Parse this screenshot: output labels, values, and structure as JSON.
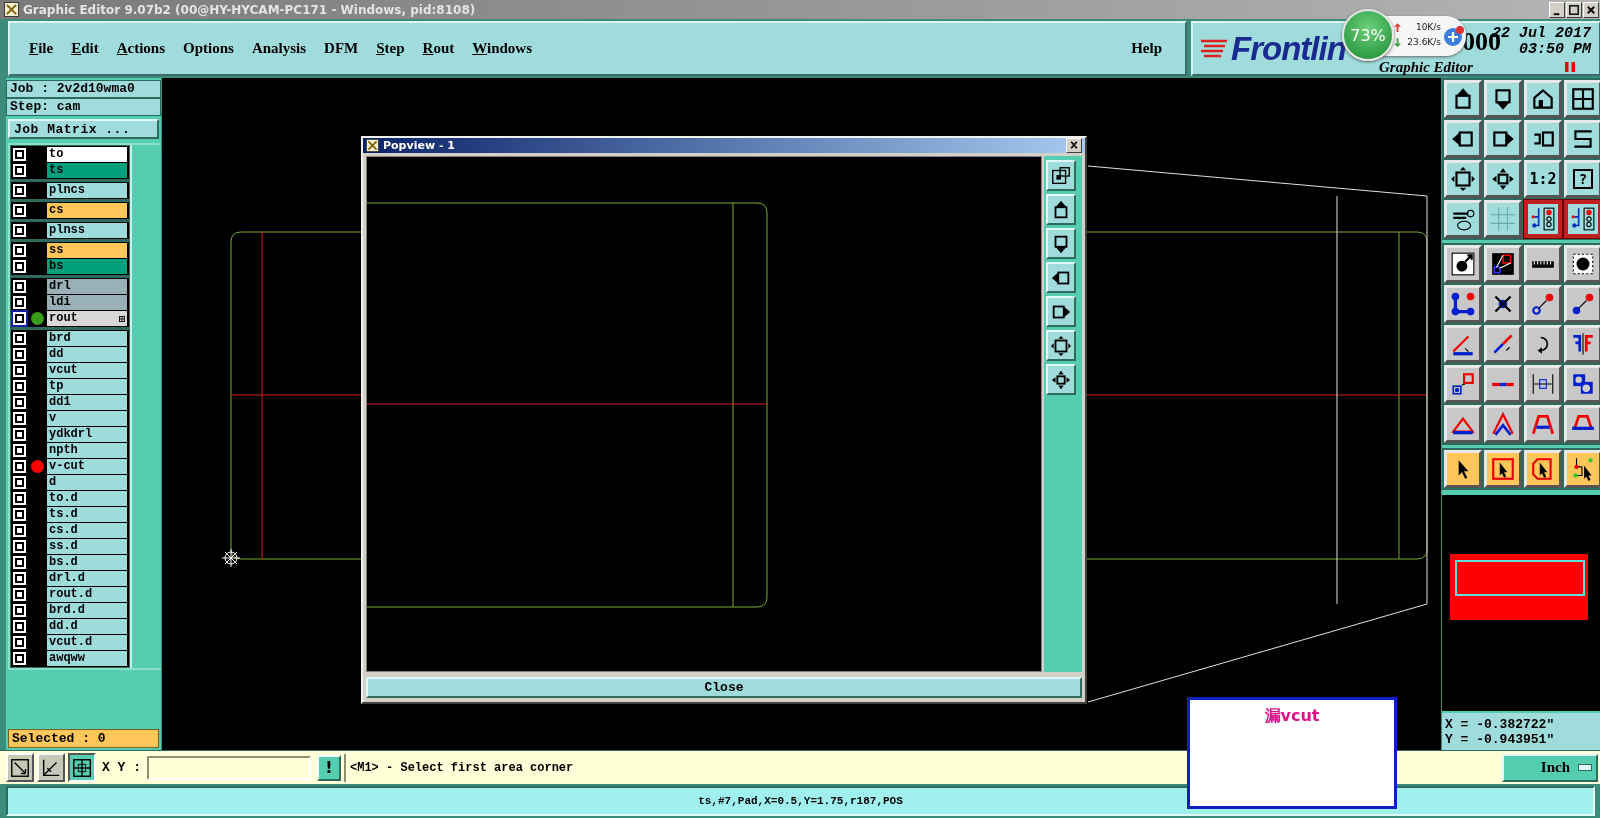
{
  "window": {
    "title": "Graphic Editor 9.07b2 (00@HY-HYCAM-PC171 - Windows, pid:8108)"
  },
  "menu": [
    {
      "label": "File",
      "mnemonic": true
    },
    {
      "label": "Edit",
      "mnemonic": true
    },
    {
      "label": "Actions",
      "mnemonic": true
    },
    {
      "label": "Options",
      "mnemonic": false
    },
    {
      "label": "Analysis",
      "mnemonic": false
    },
    {
      "label": "DFM",
      "mnemonic": false
    },
    {
      "label": "Step",
      "mnemonic": true
    },
    {
      "label": "Rout",
      "mnemonic": true
    },
    {
      "label": "Windows",
      "mnemonic": true
    }
  ],
  "help": "Help",
  "logo": {
    "brand": "Frontlin",
    "version": "000",
    "product": "Graphic Editor",
    "date": "22 Jul 2017",
    "time": "03:50 PM"
  },
  "net_widget": {
    "percent": "73%",
    "upload": "10K/s",
    "download": "23.6K/s"
  },
  "job": {
    "job": "Job : 2v2d10wma0",
    "step": "Step: cam",
    "matrix_button": "Job Matrix ..."
  },
  "layer_groups": [
    [
      {
        "name": "to",
        "color": "#ffffff",
        "selected": false
      },
      {
        "name": "ts",
        "color": "#00a07c",
        "selected": false
      }
    ],
    [
      {
        "name": "plncs",
        "color": "#9edcdc",
        "selected": false
      }
    ],
    [
      {
        "name": "cs",
        "color": "#ffc65a",
        "selected": false
      }
    ],
    [
      {
        "name": "plnss",
        "color": "#9edcdc",
        "selected": false
      }
    ],
    [
      {
        "name": "ss",
        "color": "#ffc65a",
        "selected": false
      },
      {
        "name": "bs",
        "color": "#00a07c",
        "selected": false
      }
    ],
    [
      {
        "name": "drl",
        "color": "#9ab0b8",
        "selected": false
      },
      {
        "name": "ldi",
        "color": "#9ab0b8",
        "selected": false
      },
      {
        "name": "rout",
        "color": "#d8d8d8",
        "selected": true,
        "marker": {
          "color": "#3a9a1a"
        }
      }
    ],
    [
      {
        "name": "brd",
        "color": "#9edcdc",
        "selected": false
      },
      {
        "name": "dd",
        "color": "#9edcdc",
        "selected": false
      },
      {
        "name": "vcut",
        "color": "#9edcdc",
        "selected": false
      },
      {
        "name": "tp",
        "color": "#9edcdc",
        "selected": false
      },
      {
        "name": "dd1",
        "color": "#9edcdc",
        "selected": false
      },
      {
        "name": "v",
        "color": "#9edcdc",
        "selected": false
      },
      {
        "name": "ydkdrl",
        "color": "#9edcdc",
        "selected": false
      },
      {
        "name": "npth",
        "color": "#9edcdc",
        "selected": false
      },
      {
        "name": "v-cut",
        "color": "#9edcdc",
        "selected": false,
        "marker": {
          "color": "#ff0000"
        }
      },
      {
        "name": "d",
        "color": "#9edcdc",
        "selected": false
      },
      {
        "name": "to.d",
        "color": "#9edcdc",
        "selected": false
      },
      {
        "name": "ts.d",
        "color": "#9edcdc",
        "selected": false
      },
      {
        "name": "cs.d",
        "color": "#9edcdc",
        "selected": false
      },
      {
        "name": "ss.d",
        "color": "#9edcdc",
        "selected": false
      },
      {
        "name": "bs.d",
        "color": "#9edcdc",
        "selected": false
      },
      {
        "name": "drl.d",
        "color": "#9edcdc",
        "selected": false
      },
      {
        "name": "rout.d",
        "color": "#9edcdc",
        "selected": false
      },
      {
        "name": "brd.d",
        "color": "#9edcdc",
        "selected": false
      },
      {
        "name": "dd.d",
        "color": "#9edcdc",
        "selected": false
      },
      {
        "name": "vcut.d",
        "color": "#9edcdc",
        "selected": false
      },
      {
        "name": "awqww",
        "color": "#9edcdc",
        "selected": false
      }
    ]
  ],
  "selected_count": "Selected : 0",
  "popview": {
    "title": "Popview - 1",
    "close": "Close",
    "tools": [
      {
        "kind": "zoom-box"
      },
      {
        "kind": "move-up"
      },
      {
        "kind": "move-down"
      },
      {
        "kind": "move-left"
      },
      {
        "kind": "move-right"
      },
      {
        "kind": "zoom-fit"
      },
      {
        "kind": "zoom-center"
      }
    ]
  },
  "palette": [
    {
      "kind": "view",
      "tools": [
        {
          "kind": "move-up",
          "on": false
        },
        {
          "kind": "move-down",
          "on": false
        },
        {
          "kind": "home",
          "on": false
        },
        {
          "kind": "xy-grid",
          "on": false
        },
        {
          "kind": "move-left",
          "on": false
        },
        {
          "kind": "move-right",
          "on": false
        },
        {
          "kind": "undo-box",
          "on": false
        },
        {
          "kind": "snake",
          "on": false
        },
        {
          "kind": "zoom-fit",
          "on": false
        },
        {
          "kind": "zoom-center",
          "on": false
        },
        {
          "kind": "text",
          "label": "1:2",
          "on": false
        },
        {
          "kind": "text-boxed",
          "label": "?",
          "on": false
        },
        {
          "kind": "tools",
          "on": false
        },
        {
          "kind": "grid",
          "on": false
        },
        {
          "kind": "circuit",
          "on": true
        },
        {
          "kind": "circuit",
          "on": true
        }
      ]
    },
    {
      "kind": "edit",
      "tools": [
        {
          "kind": "pad-arrow",
          "on": false
        },
        {
          "kind": "measure-box",
          "on": false
        },
        {
          "kind": "ruler",
          "on": false
        },
        {
          "kind": "dotted-pad",
          "on": false
        },
        {
          "kind": "nodes",
          "on": false
        },
        {
          "kind": "cross",
          "on": false
        },
        {
          "kind": "circle-arrow",
          "on": false
        },
        {
          "kind": "dot-arrow",
          "on": false
        },
        {
          "kind": "line-angle",
          "on": false
        },
        {
          "kind": "line-diag",
          "on": false
        },
        {
          "kind": "rotate",
          "on": false
        },
        {
          "kind": "mirror",
          "on": false
        },
        {
          "kind": "squares-arrow",
          "on": false
        },
        {
          "kind": "line-split",
          "on": false
        },
        {
          "kind": "dimension",
          "on": false
        },
        {
          "kind": "overlap",
          "on": false
        },
        {
          "kind": "triangle",
          "on": false
        },
        {
          "kind": "double-arc",
          "on": false
        },
        {
          "kind": "arc",
          "on": false
        },
        {
          "kind": "arc-line",
          "on": false
        }
      ]
    },
    {
      "kind": "select",
      "tools": [
        {
          "kind": "pointer",
          "on": false
        },
        {
          "kind": "pointer-box",
          "on": false
        },
        {
          "kind": "pointer-poly",
          "on": false
        },
        {
          "kind": "pointer-net",
          "on": false
        }
      ]
    }
  ],
  "coordinates": {
    "x": "X = -0.382722\"",
    "y": "Y = -0.943951\""
  },
  "bottom_bar": {
    "tools": [
      {
        "kind": "zoom-area",
        "on": false
      },
      {
        "kind": "zoom-angle",
        "on": false
      },
      {
        "kind": "grid-snap",
        "on": true
      }
    ],
    "xy_label": "X Y :",
    "alert_button": "!",
    "prompt": "<M1> - Select first area corner",
    "units": "Inch"
  },
  "status_bar": "ts,#7,Pad,X=0.5,Y=1.75,r187,POS",
  "note": "漏vcut"
}
